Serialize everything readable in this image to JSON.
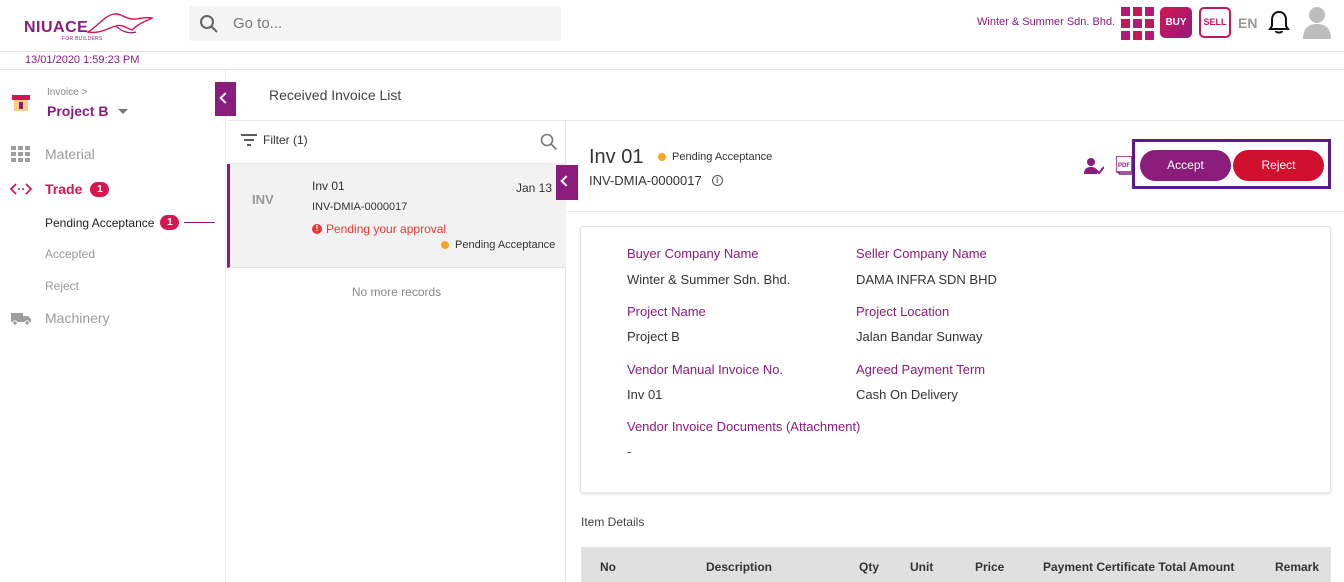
{
  "header": {
    "logo_text": "NIUACE",
    "logo_sub": "FOR BUILDERS",
    "search_placeholder": "Go to...",
    "company_name": "Winter & Summer Sdn. Bhd.",
    "buy_label": "BUY",
    "sell_label": "SELL",
    "language": "EN",
    "timestamp": "13/01/2020 1:59:23 PM"
  },
  "sidebar": {
    "breadcrumb": "Invoice >",
    "project": "Project B",
    "items": [
      {
        "label": "Material",
        "icon": "grid-icon"
      },
      {
        "label": "Trade",
        "icon": "code-icon",
        "badge": "1"
      },
      {
        "label": "Machinery",
        "icon": "truck-icon"
      }
    ],
    "sub_items": [
      {
        "label": "Pending Acceptance",
        "badge": "1",
        "active": true
      },
      {
        "label": "Accepted"
      },
      {
        "label": "Reject"
      }
    ]
  },
  "page": {
    "title": "Received Invoice List"
  },
  "list": {
    "filter_label": "Filter (1)",
    "items": [
      {
        "type": "INV",
        "name": "Inv 01",
        "date": "Jan 13",
        "number": "INV-DMIA-0000017",
        "alert": "Pending your approval",
        "status": "Pending Acceptance"
      }
    ],
    "no_more": "No more records"
  },
  "detail": {
    "title": "Inv 01",
    "status": "Pending Acceptance",
    "number": "INV-DMIA-0000017",
    "pdf_label": "PDF",
    "accept_label": "Accept",
    "reject_label": "Reject",
    "fields": {
      "buyer_company_label": "Buyer Company Name",
      "buyer_company": "Winter & Summer Sdn. Bhd.",
      "seller_company_label": "Seller Company Name",
      "seller_company": "DAMA INFRA SDN BHD",
      "project_name_label": "Project Name",
      "project_name": "Project B",
      "project_location_label": "Project Location",
      "project_location": "Jalan Bandar Sunway",
      "vendor_invoice_no_label": "Vendor Manual Invoice No.",
      "vendor_invoice_no": "Inv 01",
      "payment_term_label": "Agreed Payment Term",
      "payment_term": "Cash On Delivery",
      "attachment_label": "Vendor Invoice Documents (Attachment)",
      "attachment": "-"
    },
    "item_details_label": "Item Details",
    "table_headers": [
      "No",
      "Description",
      "Qty",
      "Unit",
      "Price",
      "Payment Certificate Total Amount",
      "Remark"
    ]
  },
  "colors": {
    "brand": "#8a1c7c",
    "accent_red": "#d6164e",
    "reject": "#d0102f",
    "pending": "#f5a623"
  }
}
